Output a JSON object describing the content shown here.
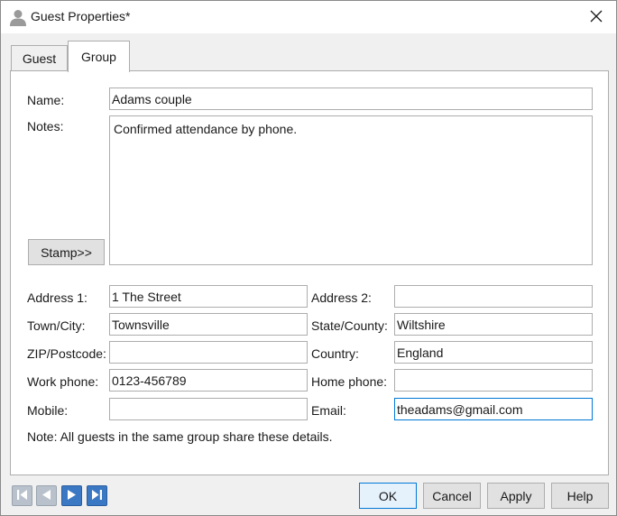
{
  "window": {
    "title": "Guest Properties*"
  },
  "tabs": [
    {
      "label": "Guest"
    },
    {
      "label": "Group"
    }
  ],
  "form": {
    "name_label": "Name:",
    "name_value": "Adams couple",
    "notes_label": "Notes:",
    "notes_value": "Confirmed attendance by phone.",
    "stamp_label": "Stamp>>",
    "address1_label": "Address 1:",
    "address1_value": "1 The Street",
    "address2_label": "Address 2:",
    "address2_value": "",
    "town_label": "Town/City:",
    "town_value": "Townsville",
    "state_label": "State/County:",
    "state_value": "Wiltshire",
    "zip_label": "ZIP/Postcode:",
    "zip_value": "",
    "country_label": "Country:",
    "country_value": "England",
    "workphone_label": "Work phone:",
    "workphone_value": "0123-456789",
    "homephone_label": "Home phone:",
    "homephone_value": "",
    "mobile_label": "Mobile:",
    "mobile_value": "",
    "email_label": "Email:",
    "email_value": "theadams@gmail.com",
    "note": "Note: All guests in the same group share these details."
  },
  "footer": {
    "ok": "OK",
    "cancel": "Cancel",
    "apply": "Apply",
    "help": "Help"
  },
  "icons": {
    "title": "user-icon",
    "close": "close-icon",
    "nav": [
      "first-icon",
      "previous-icon",
      "next-icon",
      "last-icon"
    ]
  },
  "colors": {
    "accent": "#0078d7",
    "nav_enabled": "#3a78c4",
    "nav_disabled": "#b9c2cc"
  }
}
